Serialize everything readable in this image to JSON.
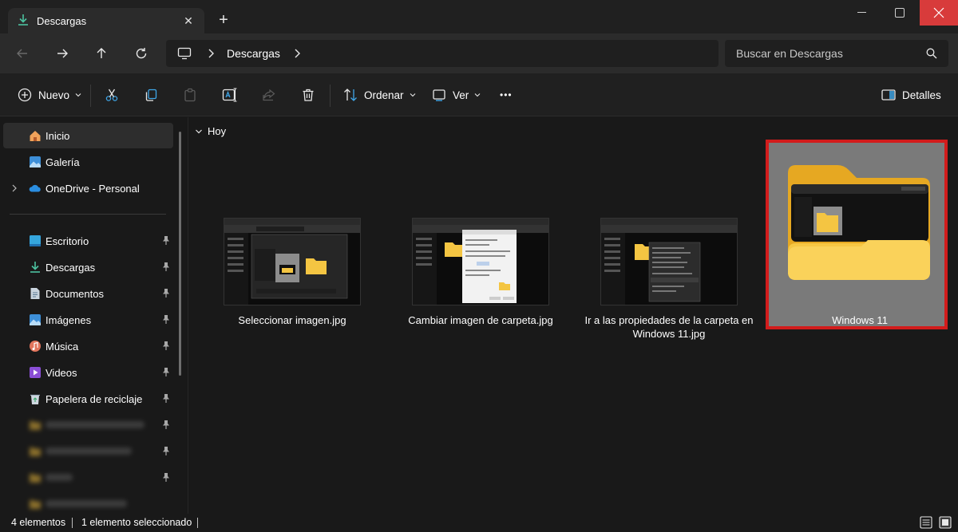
{
  "window": {
    "tab_title": "Descargas",
    "tab_icon": "download-icon",
    "new_tab_label": "+"
  },
  "navigation": {
    "address_root_icon": "this-pc-icon",
    "address_segment": "Descargas",
    "search_placeholder": "Buscar en Descargas"
  },
  "toolbar": {
    "new_label": "Nuevo",
    "sort_label": "Ordenar",
    "view_label": "Ver",
    "more_label": "•••",
    "details_label": "Detalles"
  },
  "sidebar": {
    "items": [
      {
        "label": "Inicio",
        "icon": "home-icon",
        "active": true
      },
      {
        "label": "Galería",
        "icon": "gallery-icon"
      },
      {
        "label": "OneDrive - Personal",
        "icon": "onedrive-icon",
        "expandable": true
      },
      {
        "label": "Escritorio",
        "icon": "desktop-icon",
        "pinned": true
      },
      {
        "label": "Descargas",
        "icon": "download-icon",
        "pinned": true
      },
      {
        "label": "Documentos",
        "icon": "documents-icon",
        "pinned": true
      },
      {
        "label": "Imágenes",
        "icon": "pictures-icon",
        "pinned": true
      },
      {
        "label": "Música",
        "icon": "music-icon",
        "pinned": true
      },
      {
        "label": "Videos",
        "icon": "videos-icon",
        "pinned": true
      },
      {
        "label": "Papelera de reciclaje",
        "icon": "recycle-bin-icon",
        "pinned": true
      }
    ],
    "blurred_items": [
      {
        "icon": "folder-icon",
        "pinned": true
      },
      {
        "icon": "folder-icon",
        "pinned": true
      },
      {
        "icon": "folder-icon",
        "pinned": true
      },
      {
        "icon": "folder-icon",
        "pinned": false
      }
    ]
  },
  "content": {
    "group_label": "Hoy",
    "files": [
      {
        "name": "Seleccionar imagen.jpg",
        "type": "image"
      },
      {
        "name": "Cambiar imagen de carpeta.jpg",
        "type": "image"
      },
      {
        "name": "Ir a las propiedades de la carpeta en Windows 11.jpg",
        "type": "image"
      },
      {
        "name": "Windows 11",
        "type": "folder",
        "selected": true
      }
    ]
  },
  "status": {
    "count": "4 elementos",
    "selection": "1 elemento seleccionado"
  },
  "colors": {
    "selection_border": "#d21c1c",
    "folder_yellow": "#f6c744",
    "close_button": "#d83b3b"
  }
}
